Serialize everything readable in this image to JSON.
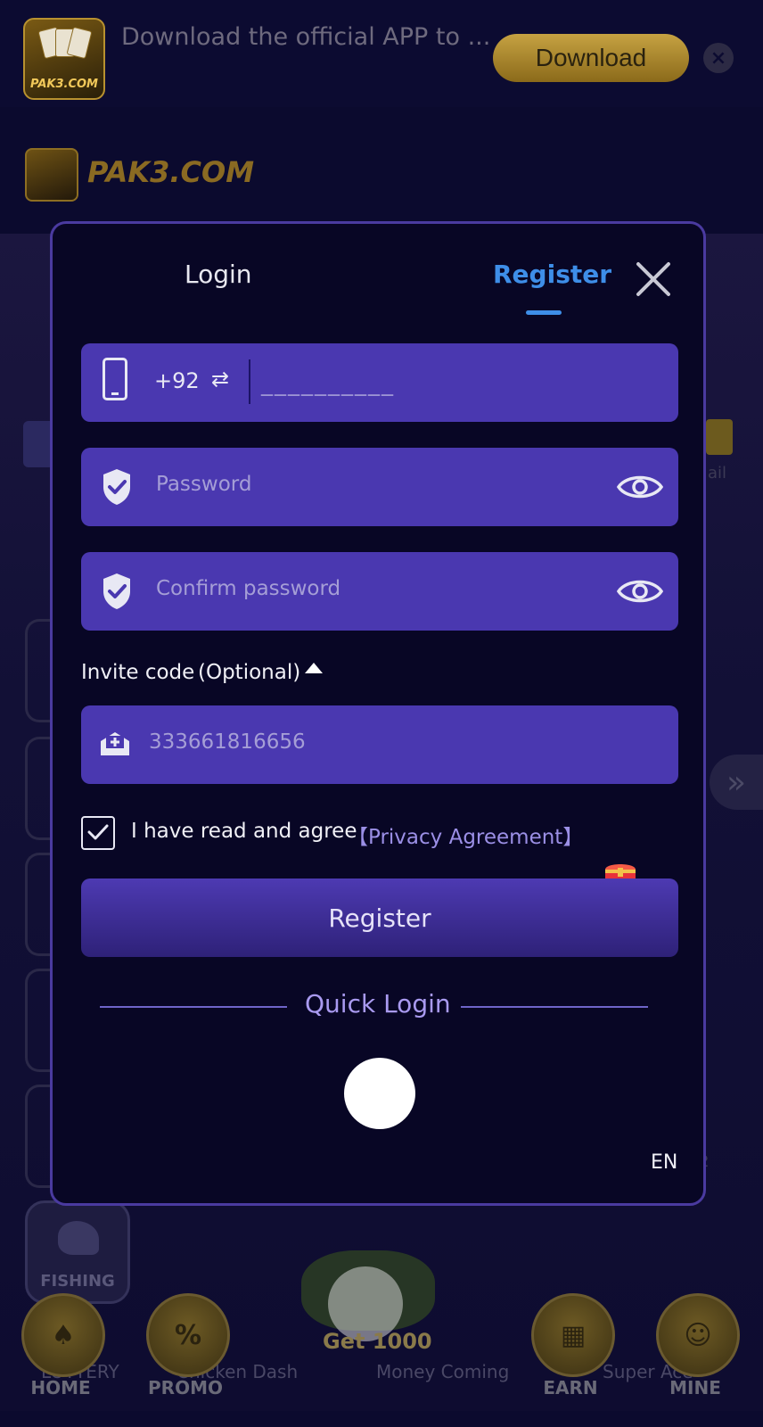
{
  "banner": {
    "app_text": "Download the official APP to ...",
    "logo_text": "PAK3.COM",
    "download_label": "Download",
    "close_symbol": "×"
  },
  "brand": {
    "name": "PAK3.COM"
  },
  "background": {
    "mail_label": "ail",
    "arrow_symbol": "»",
    "peek_text": "2",
    "fishing_label": "FISHING",
    "promo_text": "Get 1000",
    "game_names": [
      "LOTTERY",
      "Chicken Dash",
      "Money Coming",
      "Super Ace"
    ]
  },
  "bottom_nav": [
    {
      "label": "HOME",
      "icon": "spade-icon"
    },
    {
      "label": "PROMO",
      "icon": "ticket-icon"
    },
    {
      "label": "EARN",
      "icon": "gift-icon"
    },
    {
      "label": "MINE",
      "icon": "smile-icon"
    }
  ],
  "modal": {
    "tabs": {
      "login": "Login",
      "register": "Register",
      "active": "register"
    },
    "phone": {
      "country_code": "+92",
      "swap_symbol": "⇄",
      "placeholder": "__________"
    },
    "password": {
      "placeholder": "Password"
    },
    "confirm_password": {
      "placeholder": "Confirm password"
    },
    "invite": {
      "label": "Invite code",
      "optional": "(Optional)",
      "value": "333661816656"
    },
    "agreement": {
      "text": "I have read and agree",
      "link": "【Privacy Agreement】",
      "checked": true
    },
    "register_button": "Register",
    "quick_login": "Quick Login",
    "language": "EN"
  },
  "colors": {
    "accent_blue": "#3e8ee8",
    "field_purple": "#4a38b0",
    "modal_bg": "#080625",
    "modal_border": "#4a3aa0",
    "link_purple": "#9b8fe6"
  }
}
